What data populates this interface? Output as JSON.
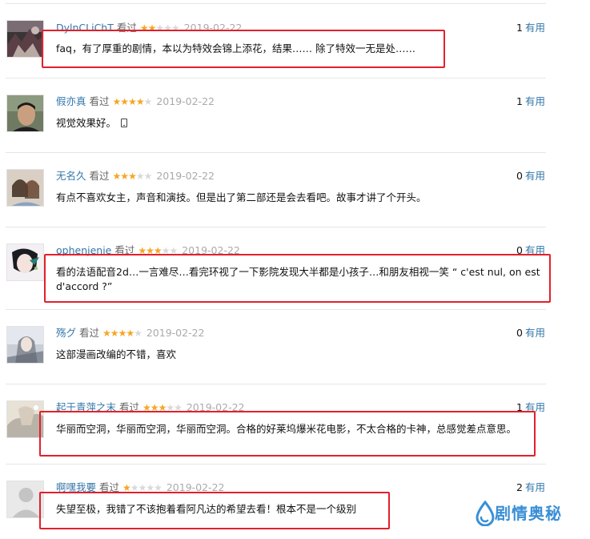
{
  "reviews": [
    {
      "user": "DylnCLiChT",
      "action": "看过",
      "stars": 2,
      "date": "2019-02-22",
      "votes": "1",
      "useful_label": "有用",
      "comment": "faq，有了厚重的剧情，本以为特效会锦上添花，结果…… 除了特效一无是处……"
    },
    {
      "user": "假亦真",
      "action": "看过",
      "stars": 4,
      "date": "2019-02-22",
      "votes": "1",
      "useful_label": "有用",
      "comment": "视觉效果好。"
    },
    {
      "user": "无名久",
      "action": "看过",
      "stars": 3,
      "date": "2019-02-22",
      "votes": "0",
      "useful_label": "有用",
      "comment": "有点不喜欢女主，声音和演技。但是出了第二部还是会去看吧。故事才讲了个开头。"
    },
    {
      "user": "ophenjenie",
      "action": "看过",
      "stars": 3,
      "date": "2019-02-22",
      "votes": "0",
      "useful_label": "有用",
      "comment": "看的法语配音2d…一言难尽…看完环视了一下影院发现大半都是小孩子…和朋友相视一笑 “ c'est nul, on est d'accord ?”"
    },
    {
      "user": "殇グ",
      "action": "看过",
      "stars": 4,
      "date": "2019-02-22",
      "votes": "0",
      "useful_label": "有用",
      "comment": "这部漫画改编的不错，喜欢"
    },
    {
      "user": "起于青萍之末",
      "action": "看过",
      "stars": 3,
      "date": "2019-02-22",
      "votes": "1",
      "useful_label": "有用",
      "comment": "华丽而空洞，华丽而空洞，华丽而空洞。合格的好莱坞爆米花电影，不太合格的卡神，总感觉差点意思。"
    },
    {
      "user": "啊嘿我要",
      "action": "看过",
      "stars": 1,
      "date": "2019-02-22",
      "votes": "2",
      "useful_label": "有用",
      "comment": "失望至极，我错了不该抱着看阿凡达的希望去看！根本不是一个级别"
    }
  ],
  "icons": {
    "phone": "phone-icon",
    "star": "star-icon",
    "watermark_logo": "drop-logo-icon"
  },
  "watermark": {
    "text": "剧情奥秘"
  },
  "colors": {
    "link": "#3377aa",
    "star": "#f5a623",
    "highlight": "#e2202c",
    "watermark": "#3a8fd6"
  }
}
